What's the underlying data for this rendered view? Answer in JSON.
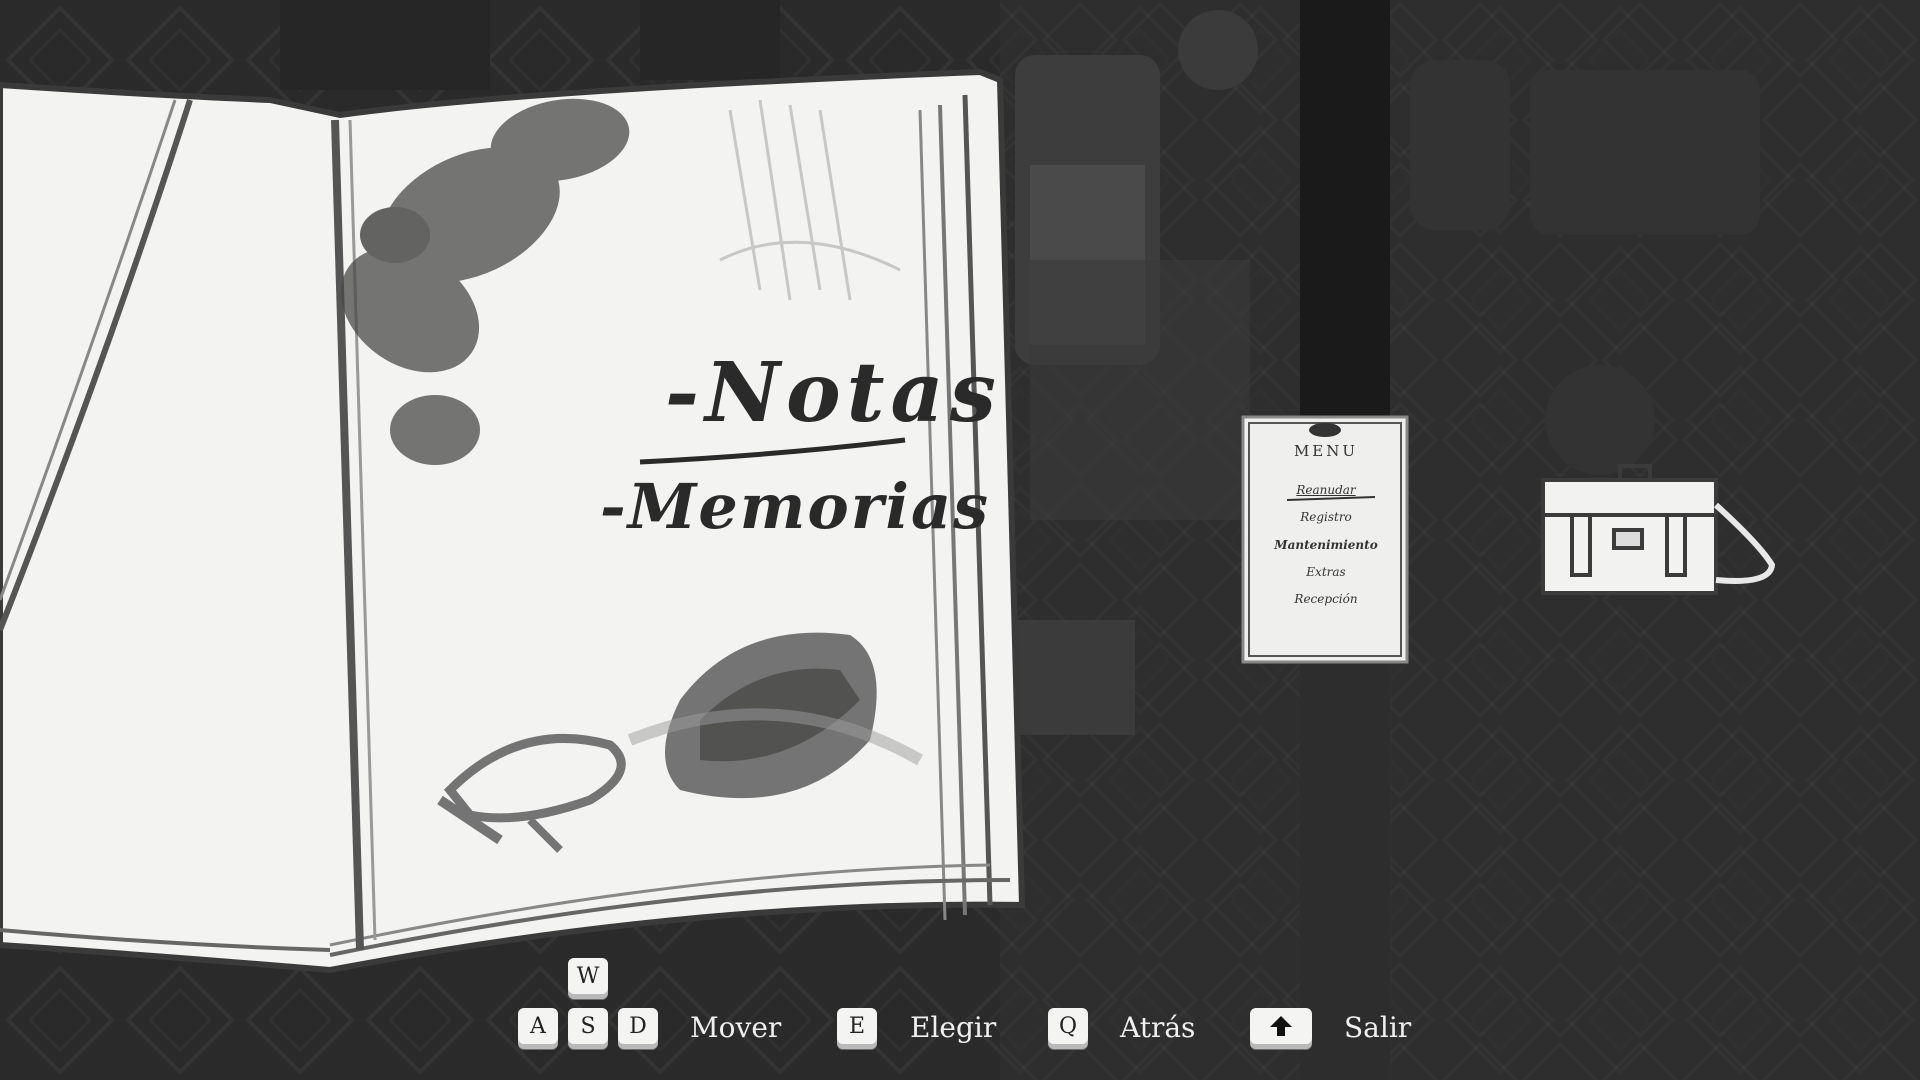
{
  "book": {
    "items": [
      {
        "label": "-Notas",
        "selected": true
      },
      {
        "label": "-Memorias",
        "selected": false
      }
    ]
  },
  "menu_card": {
    "title": "MENU",
    "items": [
      "Reanudar",
      "Registro",
      "Mantenimiento",
      "Extras",
      "Recepción"
    ],
    "selected_index": 0
  },
  "controls": {
    "move": {
      "keys": [
        "W",
        "A",
        "S",
        "D"
      ],
      "label": "Mover"
    },
    "choose": {
      "key": "E",
      "label": "Elegir"
    },
    "back": {
      "key": "Q",
      "label": "Atrás"
    },
    "exit": {
      "key_icon": "shift-arrow-icon",
      "label": "Salir"
    }
  },
  "colors": {
    "background": "#1e1e1e",
    "paper": "#f3f3f1",
    "pencil": "#2a2a2a",
    "hint_text": "#f0f0f0"
  }
}
